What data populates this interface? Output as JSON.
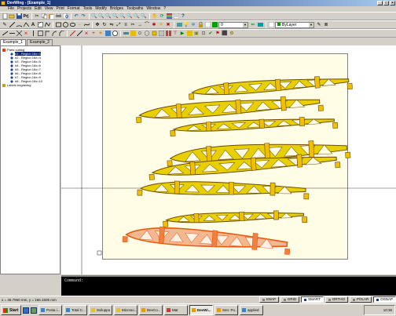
{
  "window": {
    "title": "DevWing - [Example_1]",
    "controls": [
      "_",
      "□",
      "×"
    ]
  },
  "menu": [
    "File",
    "Projects",
    "Edit",
    "View",
    "Print",
    "Format",
    "Tools",
    "Modify",
    "Bridges",
    "Toolpaths",
    "Window",
    "?"
  ],
  "toolbar": {
    "layer_combo": "0",
    "current_layer": "ByLayer"
  },
  "tabs": [
    "Example_1",
    "Example_2"
  ],
  "tree": {
    "root": "Parts cutting",
    "items": [
      "#1 - Region 16x=3",
      "#2 - Region 16x=4",
      "#3 - Region 16x=5",
      "#4 - Region 16x=6",
      "#5 - Region 16x=7",
      "#6 - Region 16x=8",
      "#7 - Region 16x=9",
      "#8 - Region 16x=10"
    ],
    "labels": "Labels engraving"
  },
  "command": {
    "prompt": "Command:"
  },
  "status": {
    "coords": "x = 46.7960 mm, y = 166.1505 mm",
    "buttons": [
      {
        "label": "SNAP",
        "on": false
      },
      {
        "label": "GRID",
        "on": false
      },
      {
        "label": "SMART",
        "on": true
      },
      {
        "label": "ORTHO",
        "on": false
      },
      {
        "label": "POLAR",
        "on": false
      },
      {
        "label": "OSNAP",
        "on": true
      }
    ]
  },
  "taskbar": {
    "start": "Start",
    "tasks": [
      {
        "label": "Posta i...",
        "active": false
      },
      {
        "label": "Total C...",
        "active": false
      },
      {
        "label": "Sviluppo",
        "active": false
      },
      {
        "label": "Microso...",
        "active": false
      },
      {
        "label": "DevCo...",
        "active": false
      },
      {
        "label": "Mat",
        "active": false
      },
      {
        "label": "DevWi...",
        "active": true
      },
      {
        "label": "Sen: Po...",
        "active": false
      },
      {
        "label": "applied",
        "active": false
      }
    ],
    "clock": "10:36"
  },
  "colors": {
    "part_fill": "#e8d000",
    "part_outline": "#6b4a00",
    "selected_part": "#e85a10",
    "selected_fill": "#f4b890",
    "sheet": "#fffde6",
    "crosshair": "#404040"
  }
}
